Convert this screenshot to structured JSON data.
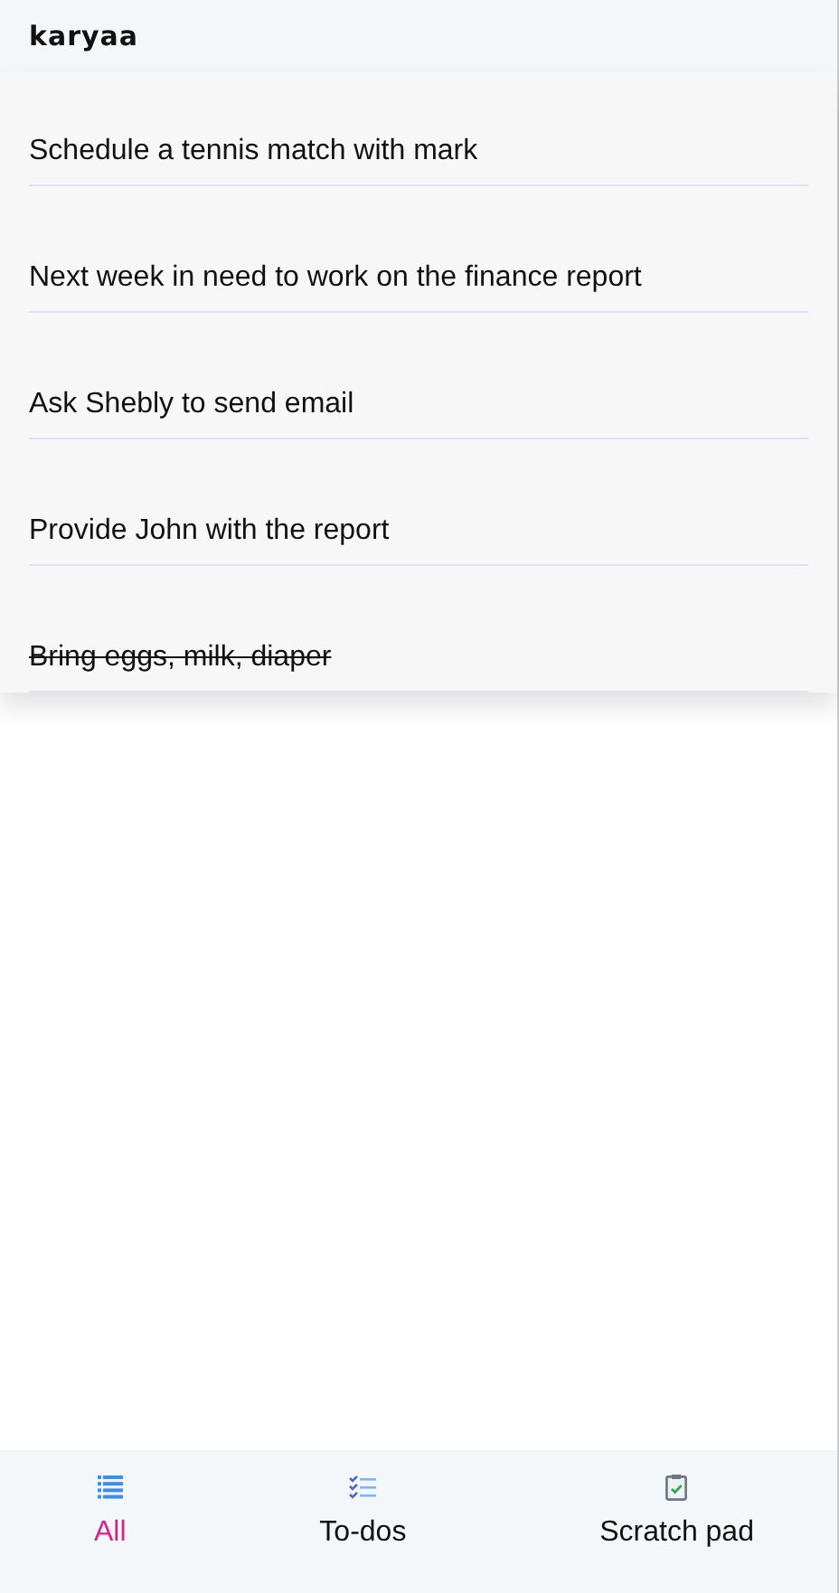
{
  "app": {
    "title": "karyaa"
  },
  "tasks": [
    {
      "text": "Schedule a tennis match with mark",
      "done": false
    },
    {
      "text": "Next week in need to work on the finance report",
      "done": false
    },
    {
      "text": "Ask Shebly to send email",
      "done": false
    },
    {
      "text": "Provide John with the report",
      "done": false
    },
    {
      "text": "Bring eggs, milk, diaper",
      "done": true
    }
  ],
  "tabs": [
    {
      "label": "All",
      "kind": "list",
      "selected": true
    },
    {
      "label": "To-dos",
      "kind": "checklist",
      "selected": false
    },
    {
      "label": "Scratch pad",
      "kind": "clipboard",
      "selected": false
    }
  ]
}
